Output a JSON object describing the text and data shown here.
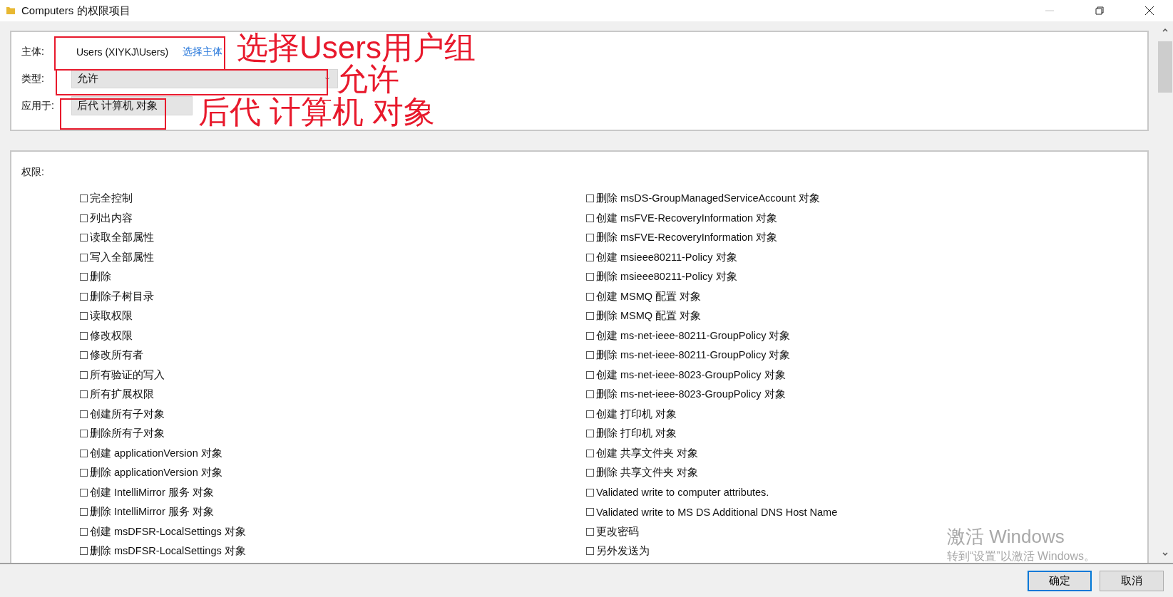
{
  "window": {
    "title": "Computers 的权限项目"
  },
  "principal": {
    "label": "主体:",
    "value": "Users (XIYKJ\\Users)",
    "link": "选择主体"
  },
  "type": {
    "label": "类型:",
    "value": "允许"
  },
  "applies_to": {
    "label": "应用于:",
    "value": "后代 计算机 对象"
  },
  "annotations": [
    "选择Users用户组",
    "允许",
    "后代 计算机 对象"
  ],
  "permissions": {
    "label": "权限:",
    "columns": [
      [
        {
          "label": "完全控制",
          "checked": false
        },
        {
          "label": "列出内容",
          "checked": false
        },
        {
          "label": "读取全部属性",
          "checked": false
        },
        {
          "label": "写入全部属性",
          "checked": false
        },
        {
          "label": "删除",
          "checked": false
        },
        {
          "label": "删除子树目录",
          "checked": false
        },
        {
          "label": "读取权限",
          "checked": false
        },
        {
          "label": "修改权限",
          "checked": false
        },
        {
          "label": "修改所有者",
          "checked": false
        },
        {
          "label": "所有验证的写入",
          "checked": false
        },
        {
          "label": "所有扩展权限",
          "checked": false
        },
        {
          "label": "创建所有子对象",
          "checked": false
        },
        {
          "label": "删除所有子对象",
          "checked": false
        },
        {
          "label": "创建 applicationVersion 对象",
          "checked": false
        },
        {
          "label": "删除 applicationVersion 对象",
          "checked": false
        },
        {
          "label": "创建 IntelliMirror 服务 对象",
          "checked": false
        },
        {
          "label": "删除 IntelliMirror 服务 对象",
          "checked": false
        },
        {
          "label": "创建 msDFSR-LocalSettings 对象",
          "checked": false
        },
        {
          "label": "删除 msDFSR-LocalSettings 对象",
          "checked": false
        }
      ],
      [
        {
          "label": "删除 msDS-GroupManagedServiceAccount 对象",
          "checked": false
        },
        {
          "label": "创建 msFVE-RecoveryInformation 对象",
          "checked": false
        },
        {
          "label": "删除 msFVE-RecoveryInformation 对象",
          "checked": false
        },
        {
          "label": "创建 msieee80211-Policy 对象",
          "checked": false
        },
        {
          "label": "删除 msieee80211-Policy 对象",
          "checked": false
        },
        {
          "label": "创建 MSMQ 配置 对象",
          "checked": false
        },
        {
          "label": "删除 MSMQ 配置 对象",
          "checked": false
        },
        {
          "label": "创建 ms-net-ieee-80211-GroupPolicy 对象",
          "checked": false
        },
        {
          "label": "删除 ms-net-ieee-80211-GroupPolicy 对象",
          "checked": false
        },
        {
          "label": "创建 ms-net-ieee-8023-GroupPolicy 对象",
          "checked": false
        },
        {
          "label": "删除 ms-net-ieee-8023-GroupPolicy 对象",
          "checked": false
        },
        {
          "label": "创建 打印机 对象",
          "checked": false
        },
        {
          "label": "删除 打印机 对象",
          "checked": false
        },
        {
          "label": "创建 共享文件夹 对象",
          "checked": false
        },
        {
          "label": "删除 共享文件夹 对象",
          "checked": false
        },
        {
          "label": "Validated write to computer attributes.",
          "checked": false
        },
        {
          "label": "Validated write to MS DS Additional DNS Host Name",
          "checked": false
        },
        {
          "label": "更改密码",
          "checked": false
        },
        {
          "label": "另外发送为",
          "checked": false
        }
      ]
    ]
  },
  "activation_notice": {
    "title": "激活 Windows",
    "text": "转到“设置”以激活 Windows。"
  },
  "buttons": [
    {
      "label": "确定",
      "default": true
    },
    {
      "label": "取消",
      "default": false
    }
  ]
}
